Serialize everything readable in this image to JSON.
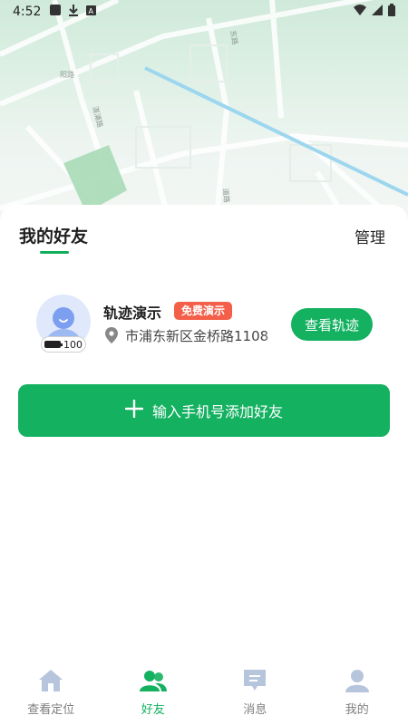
{
  "status_bar": {
    "time": "4:52",
    "icons": [
      "media-icon",
      "download-icon",
      "a-icon"
    ],
    "right_icons": [
      "wifi-icon",
      "signal-icon",
      "battery-icon"
    ]
  },
  "map": {
    "road_labels": [
      "阳路",
      "湛浦路",
      "东路",
      "道路"
    ]
  },
  "friends_section": {
    "title": "我的好友",
    "manage_label": "管理"
  },
  "friends": [
    {
      "name": "轨迹演示",
      "badge": "免费演示",
      "address": "市浦东新区金桥路1108",
      "battery": "100",
      "action_label": "查看轨迹"
    }
  ],
  "add_friend": {
    "label": "输入手机号添加好友"
  },
  "bottom_nav": {
    "items": [
      {
        "label": "查看定位",
        "icon": "home-icon"
      },
      {
        "label": "好友",
        "icon": "friends-icon"
      },
      {
        "label": "消息",
        "icon": "message-icon"
      },
      {
        "label": "我的",
        "icon": "profile-icon"
      }
    ],
    "active_index": 1
  },
  "colors": {
    "accent": "#14b161",
    "badge_red": "#f45f4a",
    "nav_inactive_icon": "#b7c5dc"
  }
}
